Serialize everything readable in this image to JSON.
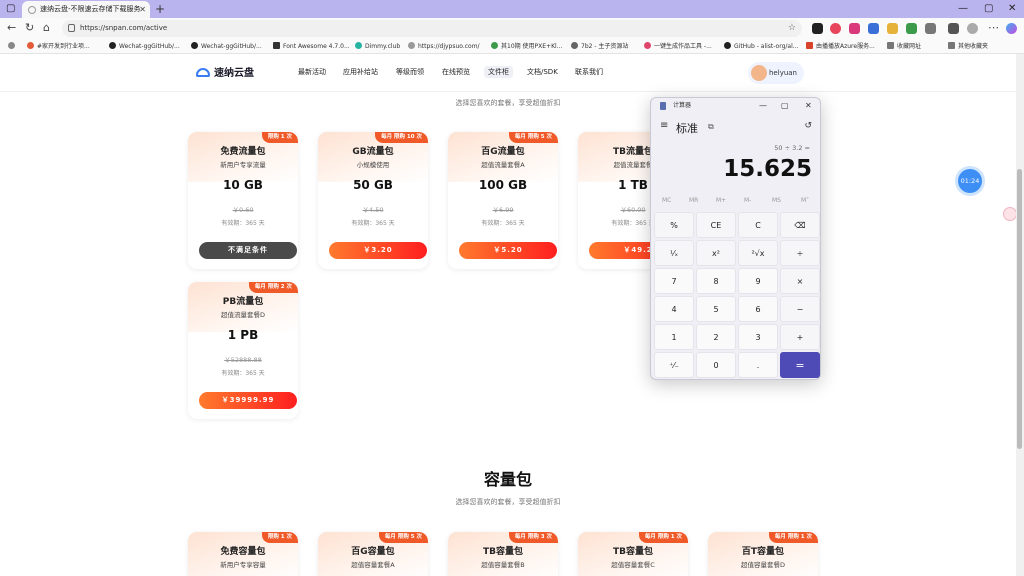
{
  "browser": {
    "tab_title": "速纳云盘-不限速云存储下载服务",
    "url": "https://snpan.com/active",
    "bookmarks": [
      "#家开发到行业项...",
      "Wechat-ggGitHub/...",
      "Wechat-ggGitHub/...",
      "Font Awesome 4.7.0...",
      "Dimmy.club",
      "https://djypsuo.com/",
      "其10期 使用PXE+Kl...",
      "7b2 - 主子资源站",
      "一键生成作品工具 -...",
      "GitHub - alist-org/al...",
      "由播播放Azure服务...",
      "收藏网址"
    ],
    "bookmark_right": "其他收藏夹"
  },
  "site": {
    "logo": "速纳云盘",
    "nav": [
      "最新活动",
      "应用补给站",
      "等级而领",
      "在线预览",
      "文件柜",
      "文档/SDK",
      "联系我们"
    ],
    "active_nav": "文件柜",
    "user": "helyuan"
  },
  "flow_section": {
    "subtitle": "选择您喜欢的套餐，享受超值折扣",
    "cards": [
      {
        "badge": "限购 1 次",
        "name": "免费流量包",
        "desc": "新用户专享流量",
        "size": "10 GB",
        "orig": "￥0.60",
        "valid": "有效期：365 天",
        "buy": "不满足条件",
        "disabled": true
      },
      {
        "badge": "每月 限购 10 次",
        "name": "GB流量包",
        "desc": "小规模使用",
        "size": "50 GB",
        "orig": "￥4.50",
        "valid": "有效期：365 天",
        "buy": "￥3.20",
        "disabled": false
      },
      {
        "badge": "每月 限购 5 次",
        "name": "百G流量包",
        "desc": "超值流量套餐A",
        "size": "100 GB",
        "orig": "￥6.99",
        "valid": "有效期：365 天",
        "buy": "￥5.20",
        "disabled": false
      },
      {
        "badge": "",
        "name": "TB流量包",
        "desc": "超值流量套餐",
        "size": "1 TB",
        "orig": "￥60.00",
        "valid": "有效期：365 天",
        "buy": "￥49.2",
        "disabled": false
      },
      {
        "badge": "每月 限购 2 次",
        "name": "PB流量包",
        "desc": "超值流量套餐D",
        "size": "1 PB",
        "orig": "￥52888.88",
        "valid": "有效期：365 天",
        "buy": "￥39999.99",
        "disabled": false
      }
    ]
  },
  "capacity_section": {
    "title": "容量包",
    "subtitle": "选择您喜欢的套餐，享受超值折扣",
    "cards": [
      {
        "badge": "限购 1 次",
        "name": "免费容量包",
        "desc": "新用户专享容量"
      },
      {
        "badge": "每月 限购 5 次",
        "name": "百G容量包",
        "desc": "超值容量套餐A"
      },
      {
        "badge": "每月 限购 3 次",
        "name": "TB容量包",
        "desc": "超值容量套餐B"
      },
      {
        "badge": "每月 限购 1 次",
        "name": "TB容量包",
        "desc": "超值容量套餐C"
      },
      {
        "badge": "每月 限购 1 次",
        "name": "百T容量包",
        "desc": "超值容量套餐D"
      }
    ]
  },
  "timer": "01:24",
  "calculator": {
    "title": "计算器",
    "mode": "标准",
    "expression": "50 ÷ 3.2 =",
    "result": "15.625",
    "memory": [
      "MC",
      "MR",
      "M+",
      "M-",
      "MS",
      "M˅"
    ],
    "keys": [
      "%",
      "CE",
      "C",
      "⌫",
      "¹⁄ₓ",
      "x²",
      "²√x",
      "÷",
      "7",
      "8",
      "9",
      "×",
      "4",
      "5",
      "6",
      "−",
      "1",
      "2",
      "3",
      "+",
      "⁺⁄₋",
      "0",
      ".",
      "="
    ]
  }
}
